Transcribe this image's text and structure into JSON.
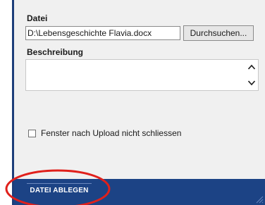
{
  "upload_form": {
    "file_label": "Datei",
    "file_value": "D:\\Lebensgeschichte Flavia.docx",
    "browse_label": "Durchsuchen...",
    "description_label": "Beschreibung",
    "description_value": "",
    "checkbox_label": "Fenster nach Upload nicht schliessen",
    "checkbox_checked": false
  },
  "footer": {
    "submit_label": "DATEI ABLEGEN"
  },
  "colors": {
    "footer_bg": "#1c4385",
    "annotation": "#e0201b"
  }
}
